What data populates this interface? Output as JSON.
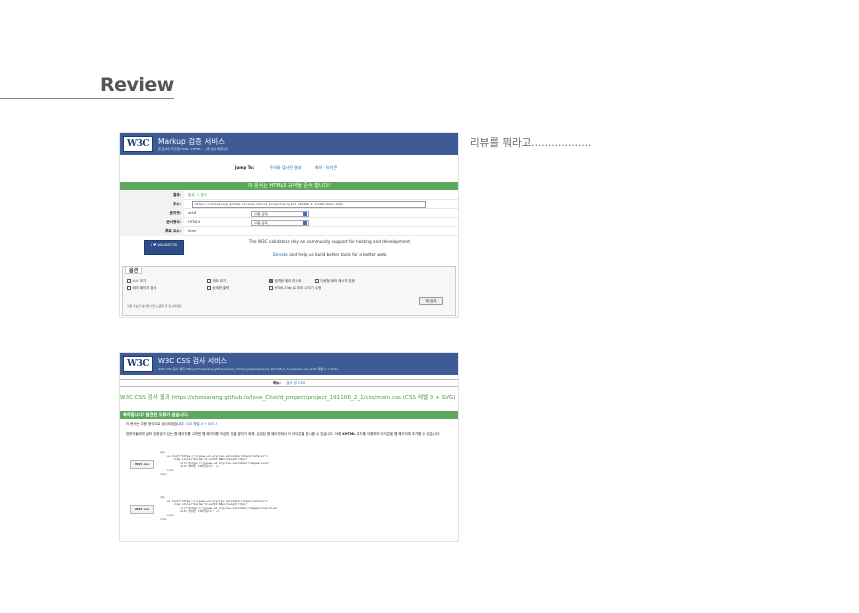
{
  "page": {
    "title": "Review",
    "side_note": "리뷰를 뭐라고.................."
  },
  "markup": {
    "logo": "W3C",
    "title": "Markup 검증 서비스",
    "subtitle": "웹 문서의 마크업(HTML, XHTML, ...)을 검사 해줍니다",
    "jump_to_label": "Jump To:",
    "jump_links": [
      "주의와 검사된 결과",
      "축하 · 아이콘"
    ],
    "banner": "이 문서는 HTML5 규약을 준수 합니다!",
    "rows": {
      "result_label": "결과:",
      "result_value": "통과, 1 경고",
      "address_label": "주소:",
      "address_value": "https://choisarang.github.io/love_Choi/d_project/project_191106_2_1/html/main.html",
      "encoding_label": "문자셋:",
      "encoding_value": "utf-8",
      "encoding_select": "(자동 감지)",
      "doctype_label": "문서형식:",
      "doctype_value": "HTML5",
      "doctype_select": "(자동 감지)",
      "root_label": "루트 요소:",
      "root_value": "html"
    },
    "badge": "I ♥ VALIDATOR",
    "support_line1": "The W3C validators rely on community support for hosting and development.",
    "support_donate": "Donate",
    "support_line2": " and help us build better tools for a better web.",
    "options": {
      "legend": "옵션",
      "items": [
        "소스 보기",
        "개요 보기",
        "엄격한 에러 리스트",
        "다량점 에러 메시지 표현",
        "에러 페이지 검사",
        "상세한 출력",
        "HTML-Tidy 로 미리 나오기 수정"
      ],
      "note_text": "이용 가능한 옵션에 관한 ",
      "note_link": "도움말",
      "note_suffix": " 을 참고하세요.",
      "check_button": "재 검사"
    }
  },
  "css": {
    "logo": "W3C",
    "title": "W3C CSS 검사 서비스",
    "subtitle": "W3C CSS 검사 결과 https://choisarang.github.io/love_Choi/d_project/project_191106_2_1/css/main.css (CSS 레벨 3 + SVG)",
    "nav_label": "메뉴:",
    "nav_link": "검사 된 CSS",
    "result_title": "W3C CSS 검사 결과 https://choisarang.github.io/love_Choi/d_project/project_191106_2_1/css/main.css (CSS 레벨 3 + SVG)",
    "banner": "축하합니다! 발견된 오류가 없습니다.",
    "line1_text": "이 문서는 다음 형식으로 검사되었습니다: ",
    "line1_link": "CSS 레벨 3 + SVG",
    "line1_suffix": " !",
    "line2_text": "방문자들에게 살보 호환성이 있는 웹 페이지를 고려한 웹 페이지를 작성한 것을 알리기 위해, 깁검된 웹 페이지에서 이 아이콘을 표시할 수 있습니다. 아래 ",
    "line2_bold": "XHTML",
    "line2_suffix": " 코드를 이용하여 아이콘을 웹 페이지에 추가할 수 있습니다:",
    "code1": "<p>\n    <a href=\"https://jigsaw.w3.org/css-validator/check/referer\">\n        <img style=\"border:0;width:88px;height:31px\"\n            src=\"https://jigsaw.w3.org/css-validator/images/vcss\"\n            alt=\"올바른 CSS입니다!\" />\n    </a>\n</p>",
    "code2": "<p>\n    <a href=\"https://jigsaw.w3.org/css-validator/check/referer\">\n        <img style=\"border:0;width:88px;height:31px\"\n            src=\"https://jigsaw.w3.org/css-validator/images/vcss-blue\"\n            alt=\"올바른 CSS입니다!\" />\n    </a>\n</p>",
    "badge1": "W3C css",
    "badge2": "W3C css"
  }
}
